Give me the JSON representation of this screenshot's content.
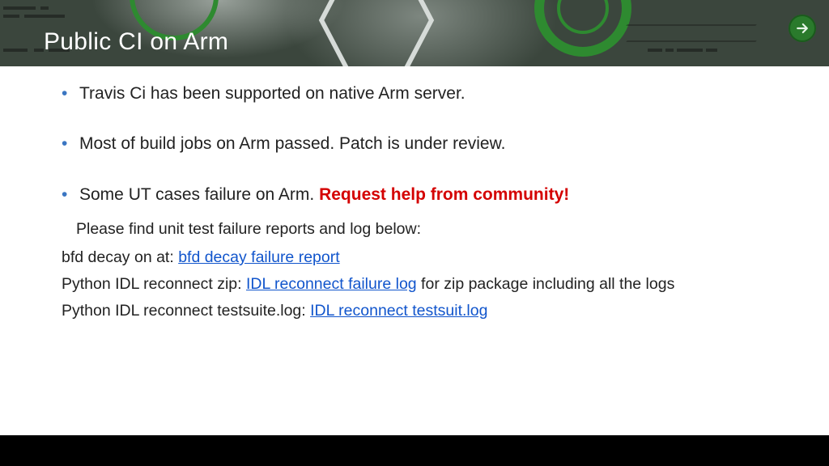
{
  "title": "Public CI on Arm",
  "bullets": [
    {
      "text": "Travis Ci has been supported on native Arm server."
    },
    {
      "text": "Most of build jobs on Arm passed. Patch is under review."
    },
    {
      "text": "Some UT cases failure on Arm.  ",
      "help_text": "Request help from community!"
    }
  ],
  "sub_note": "Please find unit test failure reports and log below:",
  "links": {
    "l1_pre": "bfd decay on at: ",
    "l1_link": "bfd decay failure report",
    "l2_pre": "Python IDL reconnect zip: ",
    "l2_link": "IDL reconnect failure log",
    "l2_post": "  for zip package including all the logs",
    "l3_pre": "Python IDL reconnect testsuite.log: ",
    "l3_link": "IDL reconnect testsuit.log"
  }
}
